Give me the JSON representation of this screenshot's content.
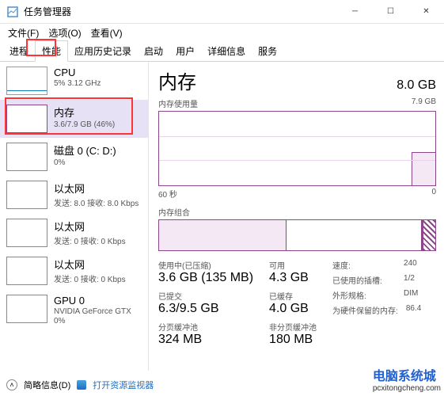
{
  "window": {
    "title": "任务管理器"
  },
  "menu": {
    "file": "文件(F)",
    "options": "选项(O)",
    "view": "查看(V)"
  },
  "tabs": {
    "processes": "进程",
    "performance": "性能",
    "appHistory": "应用历史记录",
    "startup": "启动",
    "users": "用户",
    "details": "详细信息",
    "services": "服务"
  },
  "sidebar": {
    "cpu": {
      "name": "CPU",
      "sub": "5% 3.12 GHz"
    },
    "memory": {
      "name": "内存",
      "sub": "3.6/7.9 GB (46%)"
    },
    "disk": {
      "name": "磁盘 0 (C: D:)",
      "sub": "0%"
    },
    "eth1": {
      "name": "以太网",
      "sub": "发送: 8.0 接收: 8.0 Kbps"
    },
    "eth2": {
      "name": "以太网",
      "sub": "发送: 0 接收: 0 Kbps"
    },
    "eth3": {
      "name": "以太网",
      "sub": "发送: 0 接收: 0 Kbps"
    },
    "gpu": {
      "name": "GPU 0",
      "sub1": "NVIDIA GeForce GTX",
      "sub2": "0%"
    }
  },
  "detail": {
    "title": "内存",
    "total": "8.0 GB",
    "usageLabel": "内存使用量",
    "usageMax": "7.9 GB",
    "timeLeft": "60 秒",
    "timeRight": "0",
    "compLabel": "内存组合",
    "stats": {
      "inUseLabel": "使用中(已压缩)",
      "inUse": "3.6 GB (135 MB)",
      "availLabel": "可用",
      "avail": "4.3 GB",
      "commitLabel": "已提交",
      "commit": "6.3/9.5 GB",
      "cachedLabel": "已缓存",
      "cached": "4.0 GB",
      "pagedLabel": "分页缓冲池",
      "paged": "324 MB",
      "nonpagedLabel": "非分页缓冲池",
      "nonpaged": "180 MB"
    },
    "info": {
      "speedLabel": "速度:",
      "speed": "240",
      "slotsLabel": "已使用的插槽:",
      "slots": "1/2",
      "formLabel": "外形规格:",
      "form": "DIM",
      "reservedLabel": "为硬件保留的内存:",
      "reserved": "86.4"
    }
  },
  "footer": {
    "fewer": "简略信息(D)",
    "resmon": "打开资源监视器"
  },
  "watermark": {
    "text": "电脑系统城",
    "url": "pcxitongcheng.com"
  }
}
